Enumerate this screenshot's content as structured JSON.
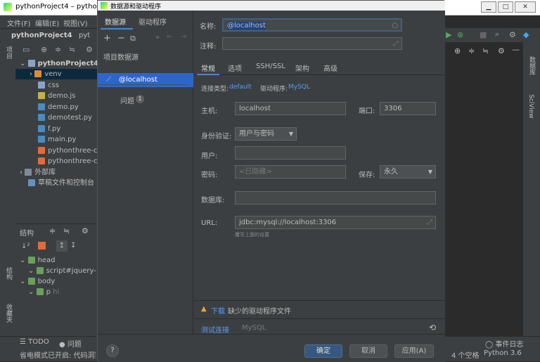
{
  "ide": {
    "title": "pythonProject4 – pytho",
    "menu": [
      "文件(F)",
      "编辑(E)",
      "视图(V)"
    ],
    "nav_project": "pythonProject4",
    "nav_file": "pyt",
    "left_tabs": [
      "项目",
      "结构",
      "收藏夹"
    ],
    "tree": [
      {
        "label": "pythonProject4",
        "type": "folder-root"
      },
      {
        "label": "venv",
        "type": "folder-orange"
      },
      {
        "label": "css",
        "type": "folder"
      },
      {
        "label": "demo.js",
        "type": "js"
      },
      {
        "label": "demo.py",
        "type": "py"
      },
      {
        "label": "demotest.py",
        "type": "py"
      },
      {
        "label": "f.py",
        "type": "py"
      },
      {
        "label": "main.py",
        "type": "py"
      },
      {
        "label": "pythonthree-c",
        "type": "html"
      },
      {
        "label": "pythonthree-c",
        "type": "html"
      },
      {
        "label": "外部库",
        "type": "lib"
      },
      {
        "label": "草稿文件和控制台",
        "type": "scratch"
      }
    ],
    "structure_title": "结构",
    "structure_tree": [
      {
        "label": "head",
        "indent": 0
      },
      {
        "label": "script#jquery-",
        "indent": 1
      },
      {
        "label": "body",
        "indent": 0
      },
      {
        "label": "p",
        "suffix": "hi",
        "indent": 1
      }
    ],
    "bottom_tabs": [
      "TODO",
      "问题"
    ],
    "status_text": "省电模式已开启: 代码洞察",
    "event_log": "事件日志",
    "status_right": [
      "4 个空格",
      "Python 3.6"
    ],
    "right_strip": [
      "数据库",
      "SciView"
    ]
  },
  "dialog": {
    "title": "数据源和驱动程序",
    "tabs": [
      "数据源",
      "驱动程序"
    ],
    "section": "项目数据源",
    "datasource": "@localhost",
    "problems_label": "问题",
    "problems_count": "1",
    "name_label": "名称:",
    "name_value": "@localhost",
    "comment_label": "注释:",
    "subtabs": [
      "常规",
      "选项",
      "SSH/SSL",
      "架构",
      "高级"
    ],
    "conn_type_label": "连接类型:",
    "conn_type_value": "default",
    "driver_label": "驱动程序:",
    "driver_value": "MySQL",
    "host_label": "主机:",
    "host_value": "localhost",
    "port_label": "端口:",
    "port_value": "3306",
    "auth_label": "身份验证:",
    "auth_value": "用户与密码",
    "user_label": "用户:",
    "password_label": "密码:",
    "password_placeholder": "<已隐藏>",
    "save_label": "保存:",
    "save_value": "永久",
    "database_label": "数据库:",
    "url_label": "URL:",
    "url_value": "jdbc:mysql://localhost:3306",
    "url_hint": "覆写上面的设置",
    "warning_link": "下载",
    "warning_text": "缺少的驱动程序文件",
    "test_link": "测试连接",
    "test_driver": "MySQL",
    "ok": "确定",
    "cancel": "取消",
    "apply": "应用(A)",
    "help": "?"
  },
  "colors": {
    "accent": "#2f65ca",
    "link": "#589df6",
    "warning": "#f0a732"
  }
}
